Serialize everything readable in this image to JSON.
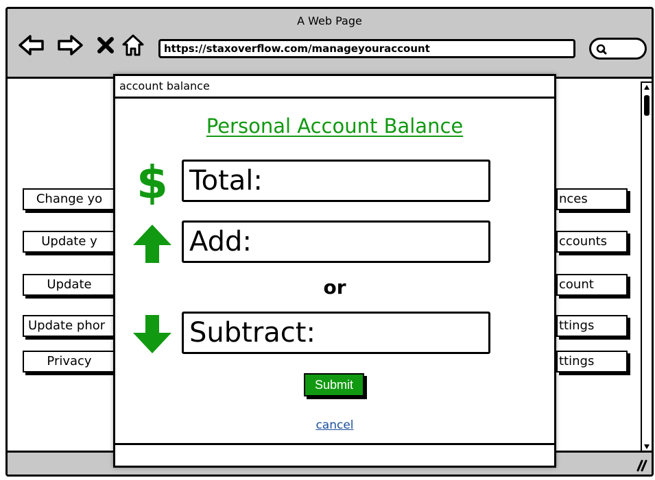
{
  "window": {
    "title": "A Web Page",
    "url": "https://staxoverflow.com/manageyouraccount"
  },
  "background_buttons": {
    "left": [
      "Change yo",
      "Update y",
      "Update",
      "Update phor",
      "Privacy"
    ],
    "right": [
      "nces",
      "ccounts",
      "count",
      "ttings",
      "ttings"
    ]
  },
  "modal": {
    "header": "account balance",
    "title": "Personal Account Balance",
    "fields": {
      "total": {
        "label": "Total:",
        "icon": "dollar-icon"
      },
      "add": {
        "label": "Add:",
        "icon": "arrow-up-icon"
      },
      "subtract": {
        "label": "Subtract:",
        "icon": "arrow-down-icon"
      }
    },
    "or_label": "or",
    "submit_label": "Submit",
    "cancel_label": "cancel"
  },
  "colors": {
    "accent_green": "#119911",
    "link_blue": "#1a4f9c",
    "chrome_gray": "#c8c8c8"
  }
}
